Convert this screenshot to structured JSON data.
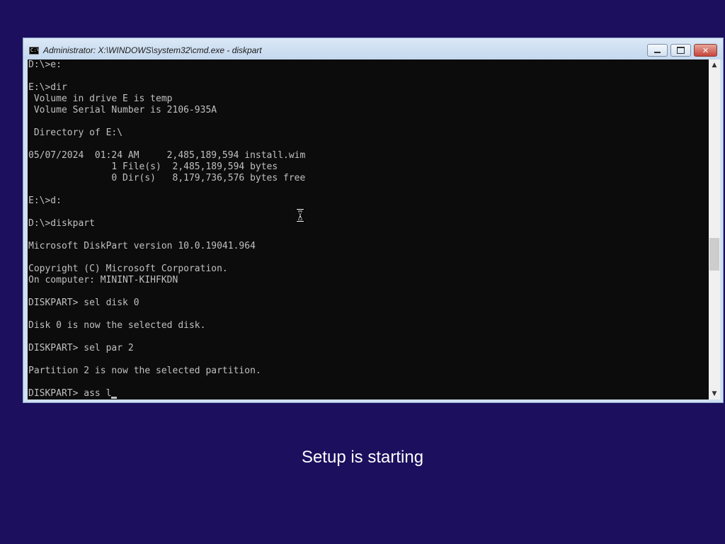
{
  "window": {
    "title": "Administrator: X:\\WINDOWS\\system32\\cmd.exe - diskpart",
    "icon_label": "C:\\"
  },
  "console": {
    "lines": [
      "D:\\>e:",
      "",
      "E:\\>dir",
      " Volume in drive E is temp",
      " Volume Serial Number is 2106-935A",
      "",
      " Directory of E:\\",
      "",
      "05/07/2024  01:24 AM     2,485,189,594 install.wim",
      "               1 File(s)  2,485,189,594 bytes",
      "               0 Dir(s)   8,179,736,576 bytes free",
      "",
      "E:\\>d:",
      "",
      "D:\\>diskpart",
      "",
      "Microsoft DiskPart version 10.0.19041.964",
      "",
      "Copyright (C) Microsoft Corporation.",
      "On computer: MININT-KIHFKDN",
      "",
      "DISKPART> sel disk 0",
      "",
      "Disk 0 is now the selected disk.",
      "",
      "DISKPART> sel par 2",
      "",
      "Partition 2 is now the selected partition.",
      "",
      "DISKPART> ass l"
    ]
  },
  "setup": {
    "status": "Setup is starting"
  },
  "colors": {
    "desktop_background": "#1b0f5e",
    "console_background": "#0c0c0c",
    "console_text": "#c0c0c0"
  },
  "icons": {
    "window_icon": "cmd-icon",
    "cursor": "hourglass-icon"
  }
}
